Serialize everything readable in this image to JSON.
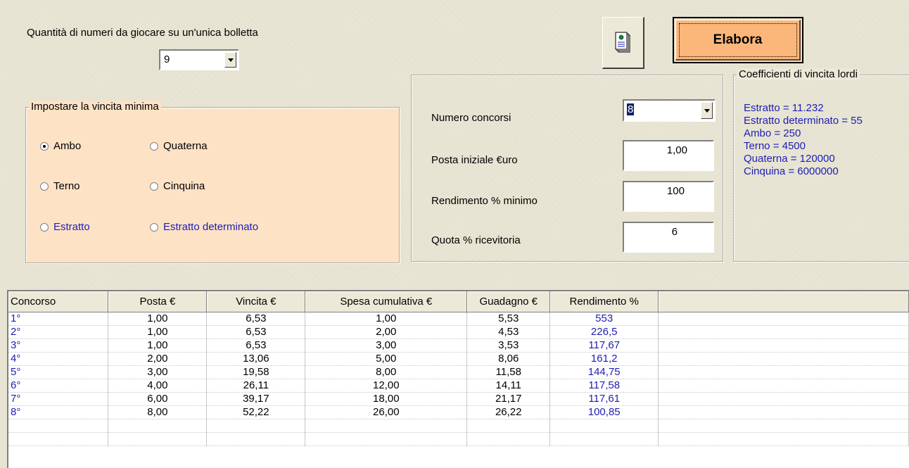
{
  "top": {
    "quantity_label": "Quantità di numeri da giocare su un'unica bolletta",
    "quantity_value": "9",
    "print_icon": "document-print-icon",
    "elabora_label": "Elabora"
  },
  "vincita_group": {
    "legend": "Impostare la vincita minima",
    "options": [
      {
        "label": "Ambo",
        "checked": true
      },
      {
        "label": "Quaterna",
        "checked": false
      },
      {
        "label": "Terno",
        "checked": false
      },
      {
        "label": "Cinquina",
        "checked": false
      },
      {
        "label": "Estratto",
        "checked": false
      },
      {
        "label": "Estratto determinato",
        "checked": false
      }
    ],
    "bg_color": "#fde2c6"
  },
  "params": {
    "numero_concorsi_label": "Numero concorsi",
    "numero_concorsi_value": "8",
    "posta_label": "Posta iniziale €uro",
    "posta_value": "1,00",
    "rendimento_label": "Rendimento % minimo",
    "rendimento_value": "100",
    "quota_label": "Quota % ricevitoria",
    "quota_value": "6"
  },
  "coefficienti": {
    "legend": "Coefficienti di vincita lordi",
    "lines": [
      "Estratto =  11.232",
      "Estratto determinato =  55",
      "Ambo =  250",
      "Terno =  4500",
      "Quaterna =  120000",
      "Cinquina =  6000000"
    ]
  },
  "table": {
    "headers": [
      "Concorso",
      "Posta €",
      "Vincita €",
      "Spesa cumulativa €",
      "Guadagno €",
      "Rendimento %"
    ],
    "rows": [
      [
        "1°",
        "1,00",
        "6,53",
        "1,00",
        "5,53",
        "553"
      ],
      [
        "2°",
        "1,00",
        "6,53",
        "2,00",
        "4,53",
        "226,5"
      ],
      [
        "3°",
        "1,00",
        "6,53",
        "3,00",
        "3,53",
        "117,67"
      ],
      [
        "4°",
        "2,00",
        "13,06",
        "5,00",
        "8,06",
        "161,2"
      ],
      [
        "5°",
        "3,00",
        "19,58",
        "8,00",
        "11,58",
        "144,75"
      ],
      [
        "6°",
        "4,00",
        "26,11",
        "12,00",
        "14,11",
        "117,58"
      ],
      [
        "7°",
        "6,00",
        "39,17",
        "18,00",
        "21,17",
        "117,61"
      ],
      [
        "8°",
        "8,00",
        "52,22",
        "26,00",
        "26,22",
        "100,85"
      ]
    ]
  },
  "colors": {
    "accent_button": "#fbb67a",
    "blue_text": "#1e1eb4"
  }
}
